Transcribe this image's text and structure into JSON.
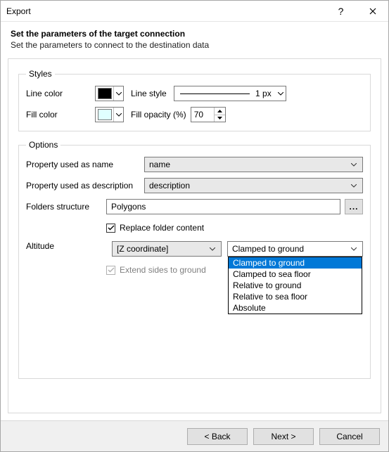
{
  "window": {
    "title": "Export"
  },
  "header": {
    "heading": "Set the parameters of the target connection",
    "subheading": "Set the parameters to connect to the destination data"
  },
  "styles": {
    "legend": "Styles",
    "line_color_label": "Line color",
    "line_color_value": "#000000",
    "line_style_label": "Line style",
    "line_style_value": "1 px",
    "fill_color_label": "Fill color",
    "fill_color_value": "#e0ffff",
    "fill_opacity_label": "Fill opacity (%)",
    "fill_opacity_value": "70"
  },
  "options": {
    "legend": "Options",
    "prop_name_label": "Property used as name",
    "prop_name_value": "name",
    "prop_desc_label": "Property used as description",
    "prop_desc_value": "description",
    "folders_label": "Folders structure",
    "folders_value": "Polygons",
    "browse_label": "...",
    "replace_label": "Replace folder content",
    "replace_checked": true,
    "altitude_label": "Altitude",
    "altitude_source": "[Z coordinate]",
    "altitude_mode": "Clamped to ground",
    "altitude_options": [
      "Clamped to ground",
      "Clamped to sea floor",
      "Relative to ground",
      "Relative to sea floor",
      "Absolute"
    ],
    "extend_label": "Extend sides to ground",
    "extend_checked": true,
    "extend_disabled": true
  },
  "footer": {
    "back": "< Back",
    "next": "Next >",
    "cancel": "Cancel"
  }
}
